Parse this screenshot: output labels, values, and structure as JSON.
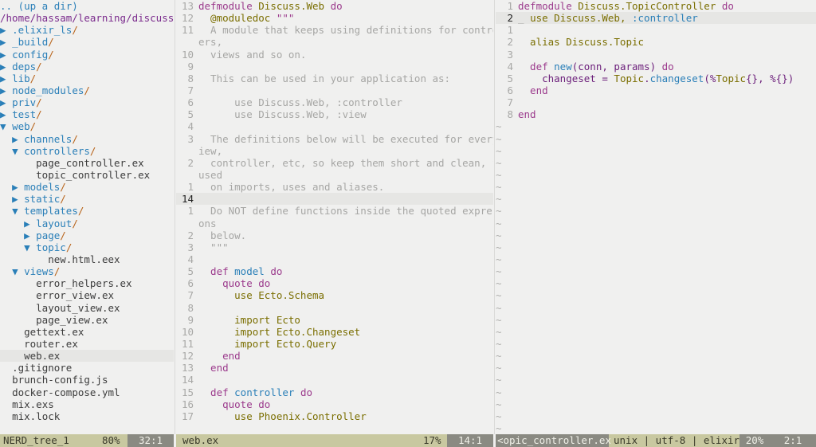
{
  "tree": {
    "rows": [
      {
        "indent": "",
        "arrow": "",
        "text": ".. (up a dir)",
        "kind": "up"
      },
      {
        "indent": "",
        "arrow": "",
        "text": "/home/hassam/learning/discuss/",
        "kind": "root"
      },
      {
        "indent": "",
        "arrow": "▶",
        "text": ".elixir_ls",
        "kind": "dir"
      },
      {
        "indent": "",
        "arrow": "▶",
        "text": "_build",
        "kind": "dir"
      },
      {
        "indent": "",
        "arrow": "▶",
        "text": "config",
        "kind": "dir"
      },
      {
        "indent": "",
        "arrow": "▶",
        "text": "deps",
        "kind": "dir"
      },
      {
        "indent": "",
        "arrow": "▶",
        "text": "lib",
        "kind": "dir"
      },
      {
        "indent": "",
        "arrow": "▶",
        "text": "node_modules",
        "kind": "dir"
      },
      {
        "indent": "",
        "arrow": "▶",
        "text": "priv",
        "kind": "dir"
      },
      {
        "indent": "",
        "arrow": "▶",
        "text": "test",
        "kind": "dir"
      },
      {
        "indent": "",
        "arrow": "▼",
        "text": "web",
        "kind": "dir"
      },
      {
        "indent": "  ",
        "arrow": "▶",
        "text": "channels",
        "kind": "dir"
      },
      {
        "indent": "  ",
        "arrow": "▼",
        "text": "controllers",
        "kind": "dir"
      },
      {
        "indent": "      ",
        "arrow": "",
        "text": "page_controller.ex",
        "kind": "file"
      },
      {
        "indent": "      ",
        "arrow": "",
        "text": "topic_controller.ex",
        "kind": "file"
      },
      {
        "indent": "  ",
        "arrow": "▶",
        "text": "models",
        "kind": "dir"
      },
      {
        "indent": "  ",
        "arrow": "▶",
        "text": "static",
        "kind": "dir"
      },
      {
        "indent": "  ",
        "arrow": "▼",
        "text": "templates",
        "kind": "dir"
      },
      {
        "indent": "    ",
        "arrow": "▶",
        "text": "layout",
        "kind": "dir"
      },
      {
        "indent": "    ",
        "arrow": "▶",
        "text": "page",
        "kind": "dir"
      },
      {
        "indent": "    ",
        "arrow": "▼",
        "text": "topic",
        "kind": "dir"
      },
      {
        "indent": "        ",
        "arrow": "",
        "text": "new.html.eex",
        "kind": "file"
      },
      {
        "indent": "  ",
        "arrow": "▼",
        "text": "views",
        "kind": "dir"
      },
      {
        "indent": "      ",
        "arrow": "",
        "text": "error_helpers.ex",
        "kind": "file"
      },
      {
        "indent": "      ",
        "arrow": "",
        "text": "error_view.ex",
        "kind": "file"
      },
      {
        "indent": "      ",
        "arrow": "",
        "text": "layout_view.ex",
        "kind": "file"
      },
      {
        "indent": "      ",
        "arrow": "",
        "text": "page_view.ex",
        "kind": "file"
      },
      {
        "indent": "    ",
        "arrow": "",
        "text": "gettext.ex",
        "kind": "file"
      },
      {
        "indent": "    ",
        "arrow": "",
        "text": "router.ex",
        "kind": "file"
      },
      {
        "indent": "    ",
        "arrow": "",
        "text": "web.ex",
        "kind": "file",
        "current": true
      },
      {
        "indent": "  ",
        "arrow": "",
        "text": ".gitignore",
        "kind": "file"
      },
      {
        "indent": "  ",
        "arrow": "",
        "text": "brunch-config.js",
        "kind": "file"
      },
      {
        "indent": "  ",
        "arrow": "",
        "text": "docker-compose.yml",
        "kind": "file"
      },
      {
        "indent": "  ",
        "arrow": "",
        "text": "mix.exs",
        "kind": "file"
      },
      {
        "indent": "  ",
        "arrow": "",
        "text": "mix.lock",
        "kind": "file"
      }
    ]
  },
  "web_pane": {
    "lines": [
      {
        "n": "13",
        "segs": [
          [
            "k",
            "defmodule "
          ],
          [
            "m",
            "Discuss.Web"
          ],
          [
            "k",
            " do"
          ]
        ]
      },
      {
        "n": "12",
        "segs": [
          [
            "v",
            "  @moduledoc "
          ],
          [
            "k",
            "\"\"\""
          ]
        ]
      },
      {
        "n": "11",
        "segs": [
          [
            "cm",
            "  A module that keeps using definitions for controll"
          ]
        ]
      },
      {
        "n": "",
        "segs": [
          [
            "cm",
            "ers,"
          ]
        ]
      },
      {
        "n": "10",
        "segs": [
          [
            "cm",
            "  views and so on."
          ]
        ]
      },
      {
        "n": "9",
        "segs": [
          [
            "cm",
            ""
          ]
        ]
      },
      {
        "n": "8",
        "segs": [
          [
            "cm",
            "  This can be used in your application as:"
          ]
        ]
      },
      {
        "n": "7",
        "segs": [
          [
            "cm",
            ""
          ]
        ]
      },
      {
        "n": "6",
        "segs": [
          [
            "cm",
            "      use Discuss.Web, :controller"
          ]
        ]
      },
      {
        "n": "5",
        "segs": [
          [
            "cm",
            "      use Discuss.Web, :view"
          ]
        ]
      },
      {
        "n": "4",
        "segs": [
          [
            "cm",
            ""
          ]
        ]
      },
      {
        "n": "3",
        "segs": [
          [
            "cm",
            "  The definitions below will be executed for every v"
          ]
        ]
      },
      {
        "n": "",
        "segs": [
          [
            "cm",
            "iew,"
          ]
        ]
      },
      {
        "n": "2",
        "segs": [
          [
            "cm",
            "  controller, etc, so keep them short and clean, foc"
          ]
        ]
      },
      {
        "n": "",
        "segs": [
          [
            "cm",
            "used"
          ]
        ]
      },
      {
        "n": "1",
        "segs": [
          [
            "cm",
            "  on imports, uses and aliases."
          ]
        ]
      },
      {
        "n": "14",
        "segs": [
          [
            "cm",
            ""
          ]
        ],
        "current": true
      },
      {
        "n": "1",
        "segs": [
          [
            "cm",
            "  Do NOT define functions inside the quoted expressi"
          ]
        ]
      },
      {
        "n": "",
        "segs": [
          [
            "cm",
            "ons"
          ]
        ]
      },
      {
        "n": "2",
        "segs": [
          [
            "cm",
            "  below."
          ]
        ]
      },
      {
        "n": "3",
        "segs": [
          [
            "cm",
            "  \"\"\""
          ]
        ]
      },
      {
        "n": "4",
        "segs": [
          [
            "cm",
            ""
          ]
        ]
      },
      {
        "n": "5",
        "segs": [
          [
            "k",
            "  def "
          ],
          [
            "b",
            "model"
          ],
          [
            "k",
            " do"
          ]
        ]
      },
      {
        "n": "6",
        "segs": [
          [
            "k",
            "    quote do"
          ]
        ]
      },
      {
        "n": "7",
        "segs": [
          [
            "m",
            "      use Ecto.Schema"
          ]
        ]
      },
      {
        "n": "8",
        "segs": [
          [
            "cm",
            ""
          ]
        ]
      },
      {
        "n": "9",
        "segs": [
          [
            "m",
            "      import Ecto"
          ]
        ]
      },
      {
        "n": "10",
        "segs": [
          [
            "m",
            "      import Ecto.Changeset"
          ]
        ]
      },
      {
        "n": "11",
        "segs": [
          [
            "m",
            "      import Ecto.Query"
          ]
        ]
      },
      {
        "n": "12",
        "segs": [
          [
            "k",
            "    end"
          ]
        ]
      },
      {
        "n": "13",
        "segs": [
          [
            "k",
            "  end"
          ]
        ]
      },
      {
        "n": "14",
        "segs": [
          [
            "cm",
            ""
          ]
        ]
      },
      {
        "n": "15",
        "segs": [
          [
            "k",
            "  def "
          ],
          [
            "b",
            "controller"
          ],
          [
            "k",
            " do"
          ]
        ]
      },
      {
        "n": "16",
        "segs": [
          [
            "k",
            "    quote do"
          ]
        ]
      },
      {
        "n": "17",
        "segs": [
          [
            "m",
            "      use Phoenix.Controller"
          ]
        ]
      }
    ]
  },
  "topic_pane": {
    "lines": [
      {
        "n": "1",
        "segs": [
          [
            "k",
            "defmodule "
          ],
          [
            "m",
            "Discuss.TopicController"
          ],
          [
            "k",
            " do"
          ]
        ]
      },
      {
        "n": "2",
        "segs": [
          [
            "cm",
            "_ "
          ],
          [
            "m",
            "use Discuss.Web, "
          ],
          [
            "y",
            ":controller"
          ]
        ],
        "current": true
      },
      {
        "n": "1",
        "segs": [
          [
            "cm",
            ""
          ]
        ]
      },
      {
        "n": "2",
        "segs": [
          [
            "m",
            "  alias Discuss.Topic"
          ]
        ]
      },
      {
        "n": "3",
        "segs": [
          [
            "cm",
            ""
          ]
        ]
      },
      {
        "n": "4",
        "segs": [
          [
            "k",
            "  def "
          ],
          [
            "b",
            "new"
          ],
          [
            "hd",
            "(conn, params)"
          ],
          [
            "k",
            " do"
          ]
        ]
      },
      {
        "n": "5",
        "segs": [
          [
            "hd",
            "    changeset = "
          ],
          [
            "m",
            "Topic"
          ],
          [
            "hd",
            "."
          ],
          [
            "b",
            "changeset"
          ],
          [
            "hd",
            "(%"
          ],
          [
            "m",
            "Topic"
          ],
          [
            "hd",
            "{}, %{})"
          ]
        ]
      },
      {
        "n": "6",
        "segs": [
          [
            "k",
            "  end"
          ]
        ]
      },
      {
        "n": "7",
        "segs": [
          [
            "cm",
            ""
          ]
        ]
      },
      {
        "n": "8",
        "segs": [
          [
            "k",
            "end"
          ]
        ]
      }
    ],
    "tilde_count": 26
  },
  "status": {
    "tree_name": "NERD_tree_1",
    "tree_pct": "80%",
    "tree_pos": "32:1",
    "web_name": "web.ex",
    "web_pct": "17%",
    "web_pos": "14:1",
    "topic_name": "<opic_controller.ex",
    "topic_info": "unix | utf-8 | elixir",
    "topic_pct": "20%",
    "topic_pos": "2:1"
  }
}
